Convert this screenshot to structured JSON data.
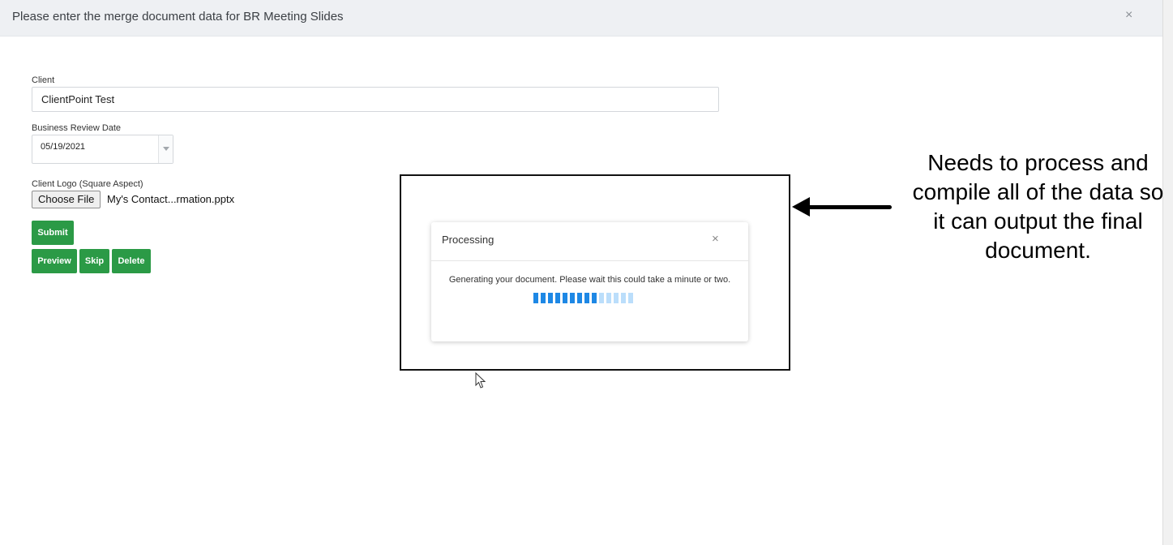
{
  "modal": {
    "title": "Please enter the merge document data for BR Meeting Slides",
    "close_glyph": "×"
  },
  "form": {
    "client_label": "Client",
    "client_value": "ClientPoint Test",
    "date_label": "Business Review Date",
    "date_value": "05/19/2021",
    "logo_label": "Client Logo (Square Aspect)",
    "choose_file_label": "Choose File",
    "file_name": "My's Contact...rmation.pptx",
    "submit_label": "Submit",
    "preview_label": "Preview",
    "skip_label": "Skip",
    "delete_label": "Delete"
  },
  "processing_dialog": {
    "title": "Processing",
    "close_glyph": "×",
    "message": "Generating your document. Please wait this could take a minute or two.",
    "progress_segments_total": 14,
    "progress_segments_filled": 9,
    "progress_color_filled": "#1e88e5",
    "progress_color_empty": "#bbdefb"
  },
  "annotation": {
    "text": "Needs to process and compile all of the data so it can output the final document."
  },
  "colors": {
    "accent_green": "#2b9a46",
    "header_bg": "#eef0f3"
  }
}
